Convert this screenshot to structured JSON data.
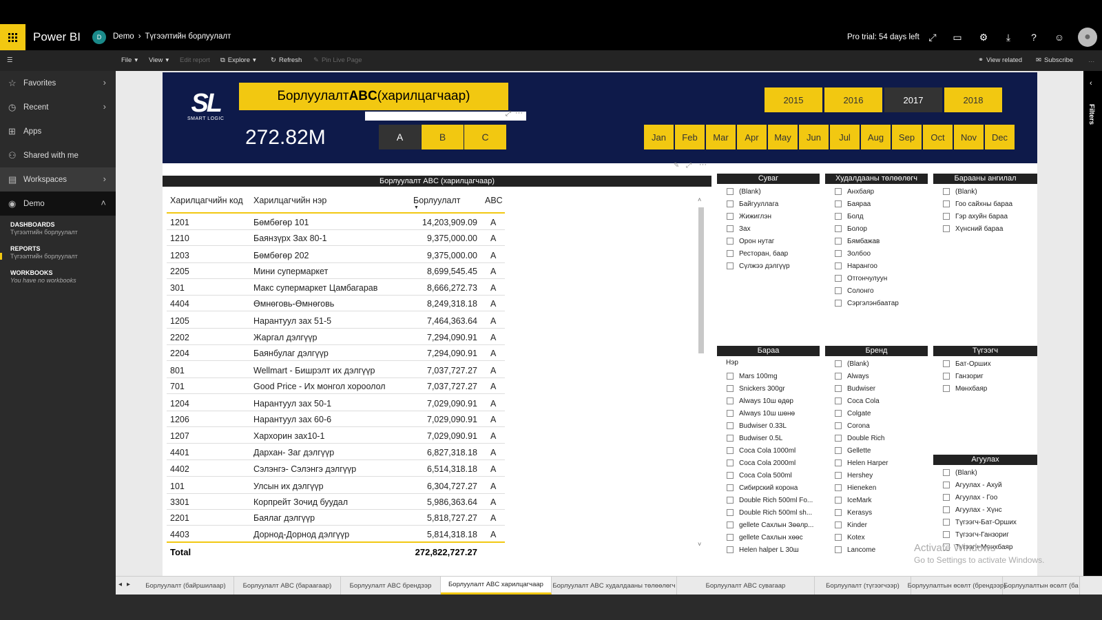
{
  "topbar": {
    "brand": "Power BI",
    "workspace_initial": "D",
    "workspace": "Demo",
    "report": "Түгээлтийн борлуулалт",
    "trial": "Pro trial: 54 days left"
  },
  "commands": {
    "file": "File",
    "view": "View",
    "edit_report": "Edit report",
    "explore": "Explore",
    "refresh": "Refresh",
    "pin": "Pin Live Page",
    "view_related": "View related",
    "subscribe": "Subscribe"
  },
  "nav": {
    "favorites": "Favorites",
    "recent": "Recent",
    "apps": "Apps",
    "shared": "Shared with me",
    "workspaces": "Workspaces",
    "demo": "Demo",
    "dashboards": "DASHBOARDS",
    "dashboard_item": "Түгээлтийн борлуулалт",
    "reports": "REPORTS",
    "report_item": "Түгээлтийн борлуулалт",
    "workbooks": "WORKBOOKS",
    "no_workbooks": "You have no workbooks"
  },
  "filters_label": "Filters",
  "header": {
    "logo": "SL",
    "logo_sub": "SMART LOGIC",
    "title_prefix": "Борлуулалт ",
    "title_bold": "ABC",
    "title_suffix": " (харилцагчаар)",
    "big_value": "272.82M",
    "abc": [
      "A",
      "B",
      "C"
    ],
    "years": [
      "2015",
      "2016",
      "2017",
      "2018"
    ],
    "selected_year": "2017",
    "months": [
      "Jan",
      "Feb",
      "Mar",
      "Apr",
      "May",
      "Jun",
      "Jul",
      "Aug",
      "Sep",
      "Oct",
      "Nov",
      "Dec"
    ]
  },
  "table": {
    "title": "Борлуулалт ABC (харилцагчаар)",
    "headers": [
      "Харилцагчийн код",
      "Харилцагчийн нэр",
      "Борлуулалт",
      "ABC"
    ],
    "rows": [
      [
        "1201",
        "Бөмбөгөр 101",
        "14,203,909.09",
        "A"
      ],
      [
        "1210",
        "Баянзүрх Зах 80-1",
        "9,375,000.00",
        "A"
      ],
      [
        "1203",
        "Бөмбөгөр 202",
        "9,375,000.00",
        "A"
      ],
      [
        "2205",
        "Мини супермаркет",
        "8,699,545.45",
        "A"
      ],
      [
        "301",
        "Макс супермаркет Цамбагарав",
        "8,666,272.73",
        "A"
      ],
      [
        "4404",
        "Өмнөговь-Өмнөговь",
        "8,249,318.18",
        "A"
      ],
      [
        "1205",
        "Нарантуул зах 51-5",
        "7,464,363.64",
        "A"
      ],
      [
        "2202",
        "Жаргал дэлгүүр",
        "7,294,090.91",
        "A"
      ],
      [
        "2204",
        "Баянбулаг дэлгүүр",
        "7,294,090.91",
        "A"
      ],
      [
        "801",
        "Wellmart - Бишрэлт их дэлгүүр",
        "7,037,727.27",
        "A"
      ],
      [
        "701",
        "Good Price - Их монгол хороолол",
        "7,037,727.27",
        "A"
      ],
      [
        "1204",
        "Нарантуул зах 50-1",
        "7,029,090.91",
        "A"
      ],
      [
        "1206",
        "Нарантуул зах 60-6",
        "7,029,090.91",
        "A"
      ],
      [
        "1207",
        "Хархорин зах10-1",
        "7,029,090.91",
        "A"
      ],
      [
        "4401",
        "Дархан- Заг дэлгүүр",
        "6,827,318.18",
        "A"
      ],
      [
        "4402",
        "Сэлэнгэ- Сэлэнгэ дэлгүүр",
        "6,514,318.18",
        "A"
      ],
      [
        "101",
        "Улсын их дэлгүүр",
        "6,304,727.27",
        "A"
      ],
      [
        "3301",
        "Корпрейт Зочид буудал",
        "5,986,363.64",
        "A"
      ],
      [
        "2201",
        "Баялаг дэлгүүр",
        "5,818,727.27",
        "A"
      ],
      [
        "4403",
        "Дорнод-Дорнод дэлгүүр",
        "5,814,318.18",
        "A"
      ]
    ],
    "total_label": "Total",
    "total_value": "272,822,727.27"
  },
  "slicers": {
    "suvag": {
      "title": "Суваг",
      "items": [
        "(Blank)",
        "Байгууллага",
        "Жижиглэн",
        "Зах",
        "Орон нутаг",
        "Ресторан, баар",
        "Сүлжээ дэлгүүр"
      ]
    },
    "plan": {
      "title": "Худалдааны төлөөлөгч",
      "items": [
        "Анхбаяр",
        "Баяраа",
        "Болд",
        "Болор",
        "Бямбажав",
        "Золбоо",
        "Нарангоо",
        "Отгончулуун",
        "Солонго",
        "Сэргэлэнбаатар"
      ]
    },
    "category": {
      "title": "Барааны ангилал",
      "items": [
        "(Blank)",
        "Гоо сайхны бараа",
        "Гэр ахуйн бараа",
        "Хүнсний бараа"
      ]
    },
    "product": {
      "title": "Бараа",
      "subheader": "Нэр",
      "items": [
        "Mars 100mg",
        "Snickers 300gr",
        "Always 10ш өдөр",
        "Always 10ш шөнө",
        "Budwiser 0.33L",
        "Budwiser 0.5L",
        "Coca Cola 1000ml",
        "Coca Cola 2000ml",
        "Coca Cola 500ml",
        "Сибирский корона",
        "Double Rich 500ml Fo...",
        "Double Rich 500ml sh...",
        "gellete Сахлын Зөөлр...",
        "gellete Сахлын хөөс",
        "Helen halper L 30ш"
      ]
    },
    "brand": {
      "title": "Бренд",
      "items": [
        "(Blank)",
        "Always",
        "Budwiser",
        "Coca Cola",
        "Colgate",
        "Corona",
        "Double Rich",
        "Gellette",
        "Helen Harper",
        "Hershey",
        "Hieneken",
        "IceMark",
        "Kerasys",
        "Kinder",
        "Kotex",
        "Lancome"
      ]
    },
    "distributor": {
      "title": "Түгээгч",
      "items": [
        "Бат-Орших",
        "Ганзориг",
        "Мөнхбаяр"
      ]
    },
    "warehouse": {
      "title": "Агуулах",
      "items": [
        "(Blank)",
        "Агуулах - Ахуй",
        "Агуулах - Гоо",
        "Агуулах - Хүнс",
        "Түгээгч-Бат-Орших",
        "Түгээгч-Ганзориг",
        "Түгээгч-Мөнхбаяр"
      ]
    }
  },
  "watermark": {
    "line1": "Activate Windows",
    "line2": "Go to Settings to activate Windows."
  },
  "tabs": [
    "Борлуулалт (байршилаар)",
    "Борлуулалт ABC (бараагаар)",
    "Борлуулалт ABC брендээр",
    "Борлуулалт ABC харилцагчаар",
    "Борлуулалт ABC худалдааны төлөөлөгч",
    "Борлуулалт ABC сувагаар",
    "Борлуулалт (түгээгчээр)",
    "Борлуулалтын өсөлт (брендээр)",
    "Борлуулалтын өсөлт (ба"
  ],
  "selected_tab": "Борлуулалт ABC харилцагчаар",
  "colors": {
    "accent": "#f2c811",
    "header_bg": "#0e1a4a",
    "dark": "#222222"
  }
}
